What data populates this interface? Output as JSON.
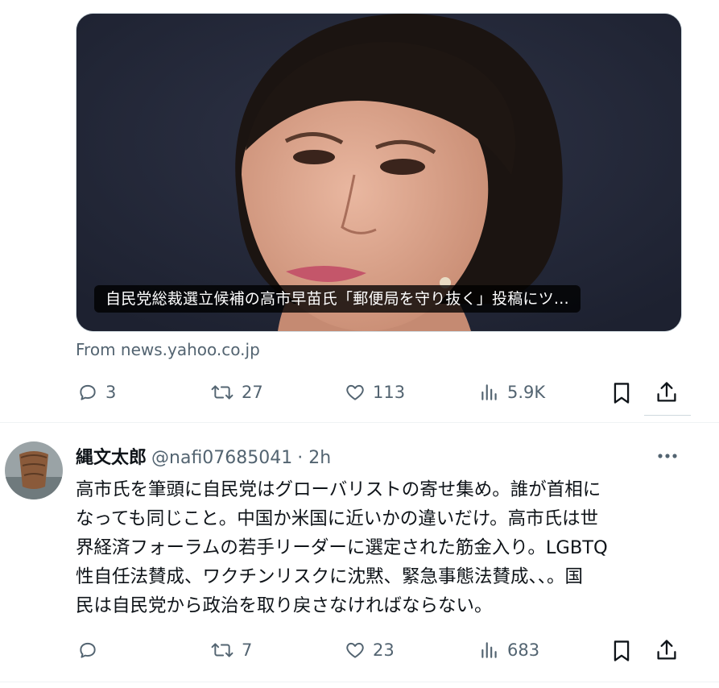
{
  "tweet1": {
    "link_card": {
      "caption": "自民党総裁選立候補の高市早苗氏「郵便局を守り抜く」投稿にツ…",
      "image_icon": "portrait-photo"
    },
    "source": "From news.yahoo.co.jp",
    "actions": {
      "replies": "3",
      "reposts": "27",
      "likes": "113",
      "views": "5.9K"
    }
  },
  "tweet2": {
    "author": {
      "name": "縄文太郎",
      "handle": "@nafi07685041",
      "time": "· 2h"
    },
    "more_icon": "more-dots-icon",
    "body_lines": [
      "高市氏を筆頭に自民党はグローバリストの寄せ集め。誰が首相に",
      "なっても同じこと。中国か米国に近いかの違いだけ。高市氏は世",
      "界経済フォーラムの若手リーダーに選定された筋金入り。LGBTQ",
      "性自任法賛成、ワクチンリスクに沈黙、緊急事態法賛成、、。国",
      "民は自民党から政治を取り戻さなければならない。"
    ],
    "actions": {
      "replies": "",
      "reposts": "7",
      "likes": "23",
      "views": "683"
    }
  },
  "colors": {
    "text": "#0f1419",
    "secondary": "#536471",
    "border": "#cfd9de",
    "caption_bg": "#000000"
  }
}
